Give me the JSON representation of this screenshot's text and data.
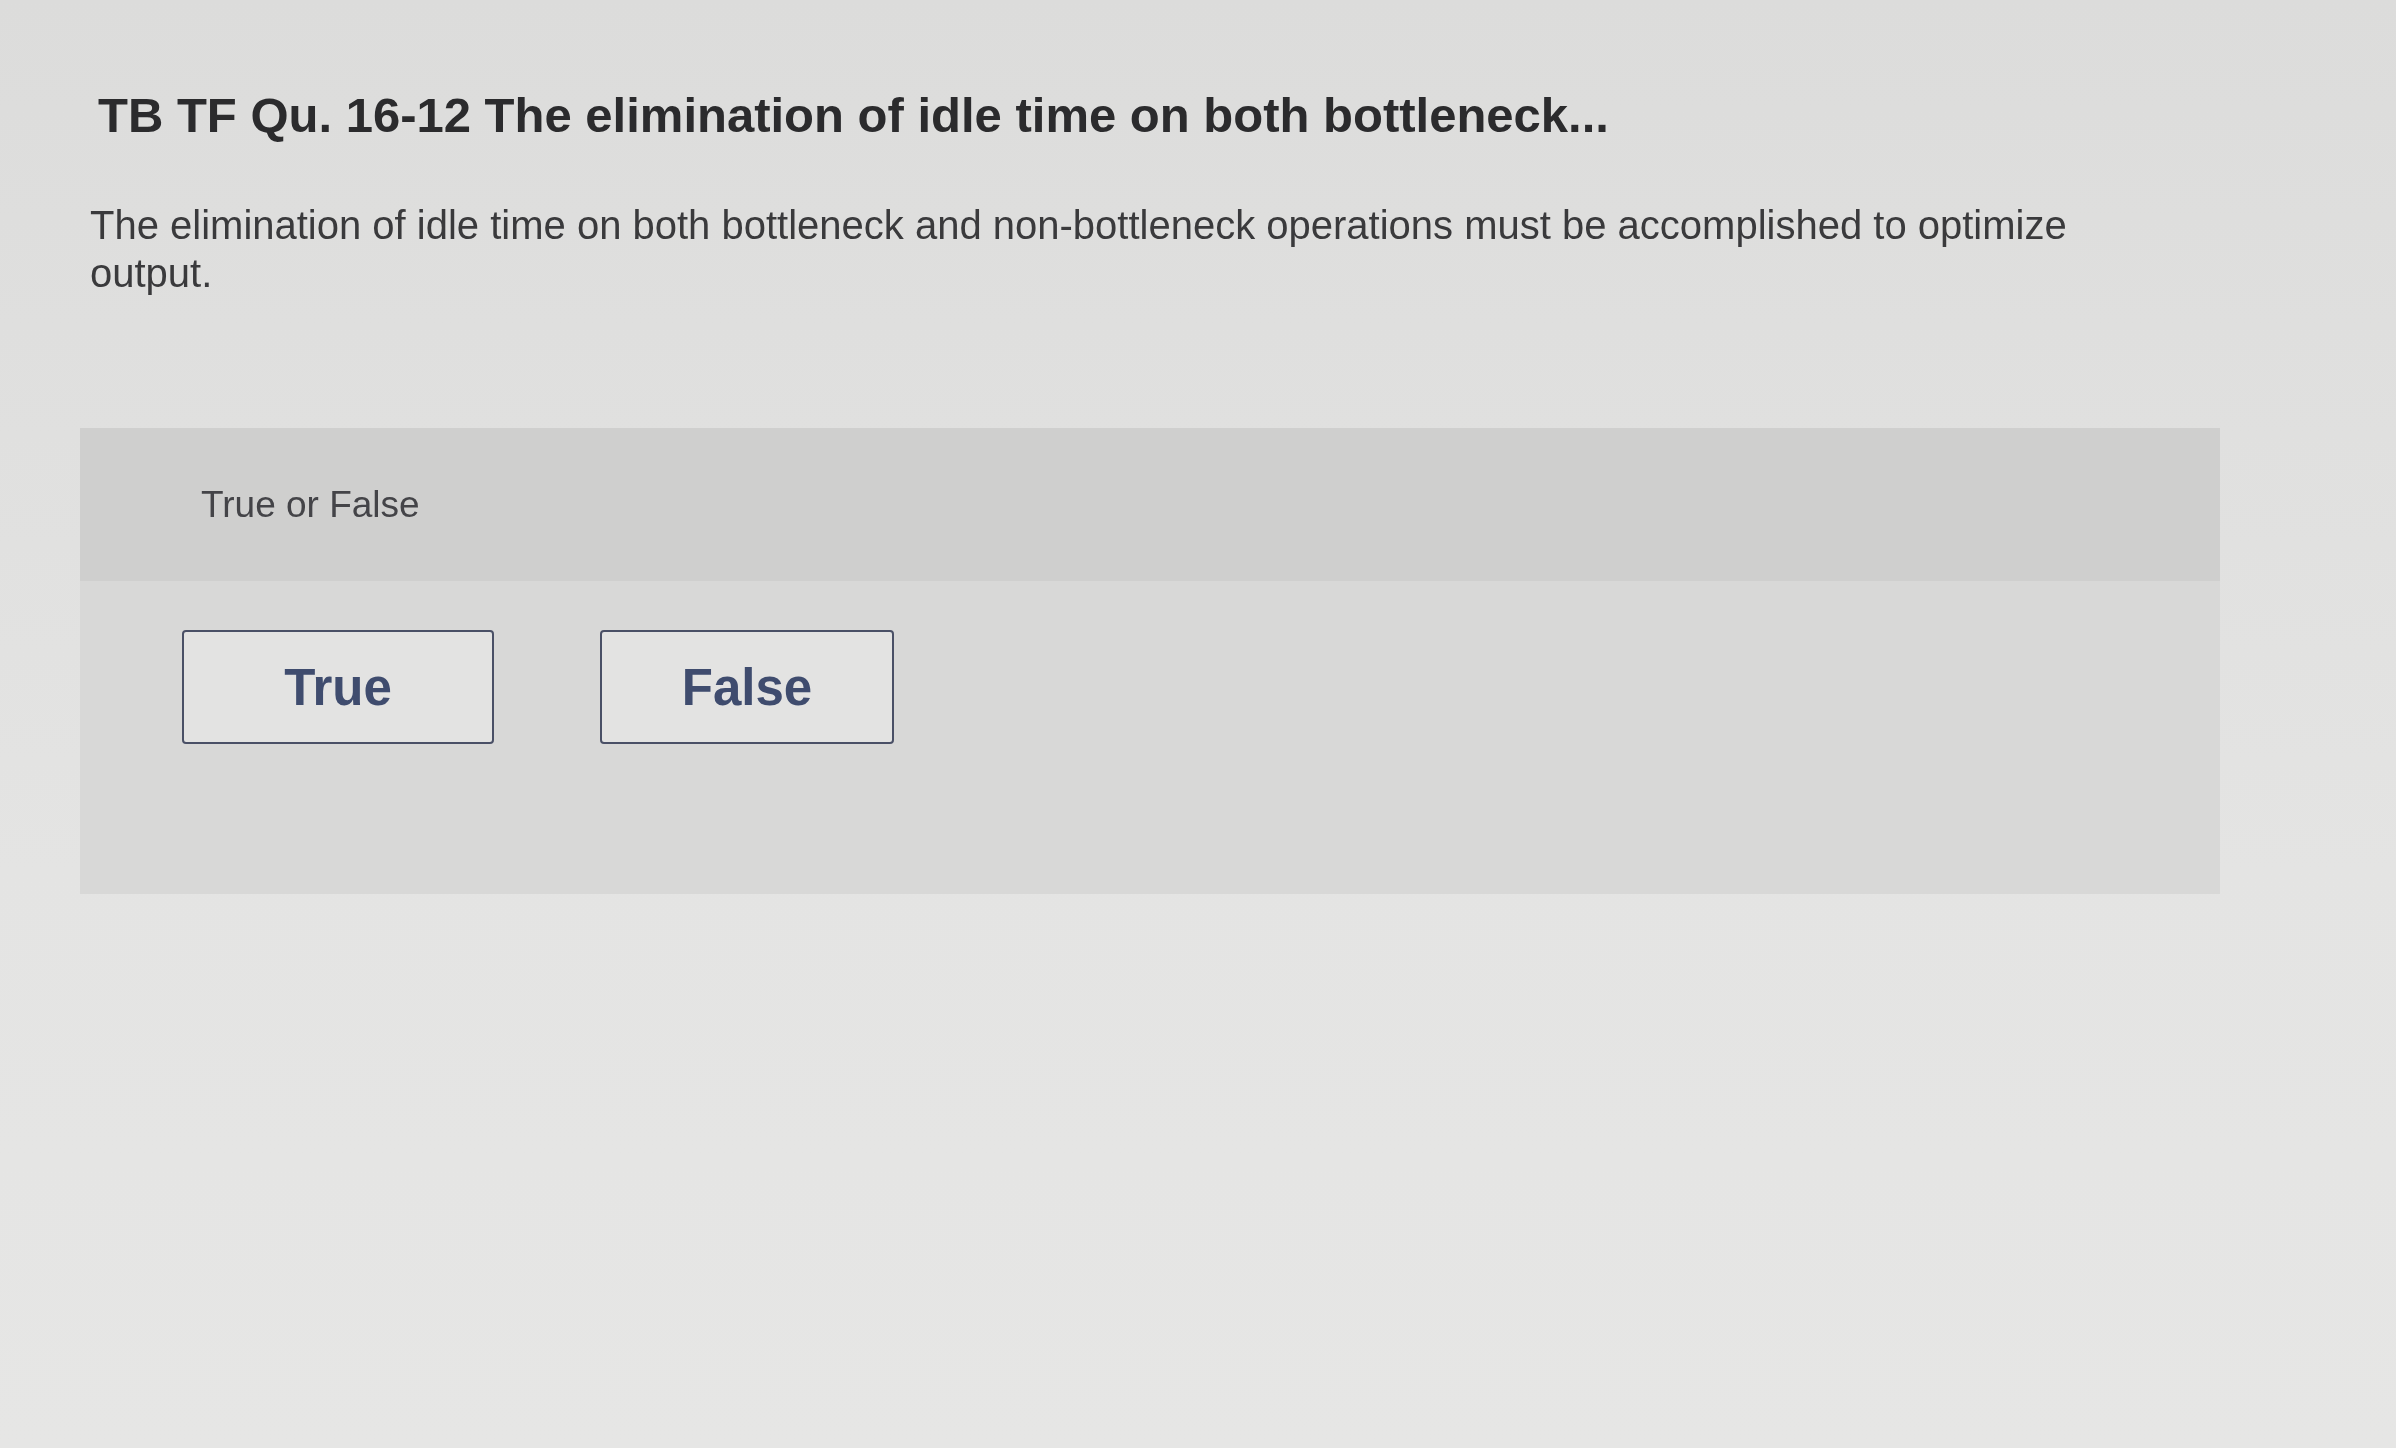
{
  "question": {
    "title": "TB TF Qu. 16-12 The elimination of idle time on both bottleneck...",
    "prompt": "The elimination of idle time on both bottleneck and non-bottleneck operations must be accomplished to optimize output."
  },
  "answer_panel": {
    "heading": "True or False",
    "options": [
      {
        "label": "True",
        "selected": false
      },
      {
        "label": "False",
        "selected": false
      }
    ]
  }
}
